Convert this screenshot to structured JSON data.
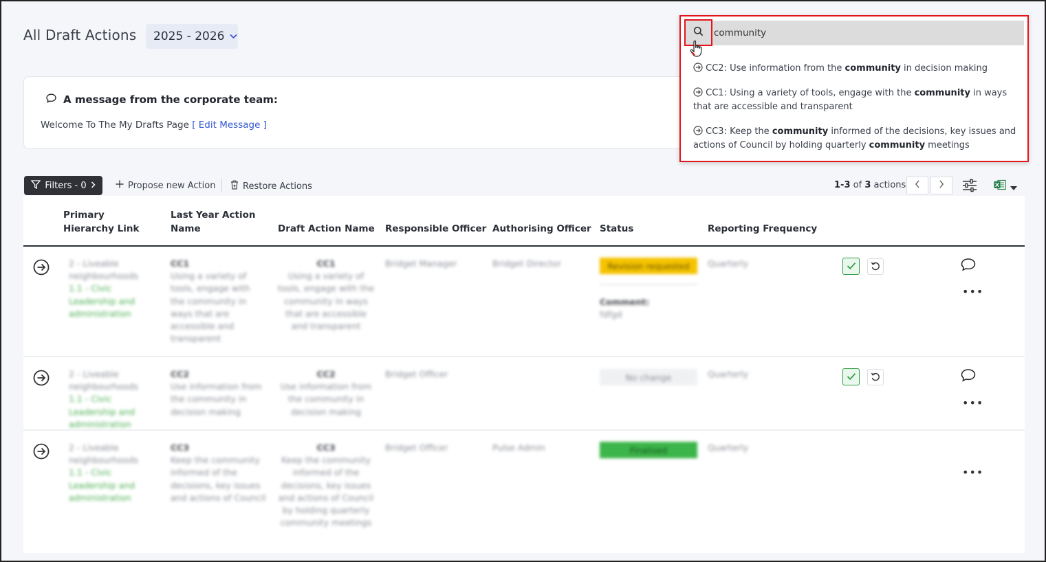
{
  "header": {
    "title": "All Draft Actions",
    "year": "2025 - 2026"
  },
  "message": {
    "title": "A message from the corporate team:",
    "body": "Welcome To The My Drafts Page",
    "link": "[ Edit Message ]"
  },
  "search": {
    "value": "community",
    "results": [
      {
        "prefix": "CC2: Use information from the ",
        "bold": "community",
        "suffix": " in decision making"
      },
      {
        "prefix": "CC1: Using a variety of tools, engage with the ",
        "bold": "community",
        "suffix": " in ways that are accessible and transparent"
      },
      {
        "prefix": "CC3: Keep the ",
        "bold": "community",
        "mid": " informed of the decisions, key issues and actions of Council by holding quarterly ",
        "bold2": "community",
        "suffix": " meetings"
      }
    ]
  },
  "toolbar": {
    "filters": "Filters - 0",
    "propose": "Propose new Action",
    "restore": "Restore Actions",
    "count_range": "1-3",
    "count_of": "of",
    "count_total": "3",
    "count_unit": "actions"
  },
  "table": {
    "headers": {
      "primary": "Primary Hierarchy Link",
      "last_year": "Last Year Action Name",
      "draft": "Draft Action Name",
      "responsible": "Responsible Officer",
      "authorising": "Authorising Officer",
      "status": "Status",
      "frequency": "Reporting Frequency"
    },
    "rows": [
      {
        "hier1": "2 - Liveable neighbourhoods",
        "hier2": "1.1 - Civic Leadership and administration",
        "last_code": "CC1",
        "last_text": "Using a variety of tools, engage with the community in ways that are accessible and transparent",
        "draft_code": "CC1",
        "draft_text": "Using a variety of tools, engage with the community in ways that are accessible and transparent",
        "responsible": "Bridget Manager",
        "authorising": "Bridget Director",
        "status": "Revision requested",
        "comment_label": "Comment:",
        "comment_text": "fdfgd",
        "frequency": "Quarterly"
      },
      {
        "hier1": "2 - Liveable neighbourhoods",
        "hier2": "1.1 - Civic Leadership and administration",
        "last_code": "CC2",
        "last_text": "Use information from the community in decision making",
        "draft_code": "CC2",
        "draft_text": "Use information from the community in decision making",
        "responsible": "Bridget Officer",
        "authorising": "",
        "status": "No change",
        "frequency": "Quarterly"
      },
      {
        "hier1": "2 - Liveable neighbourhoods",
        "hier2": "1.1 - Civic Leadership and administration",
        "last_code": "CC3",
        "last_text": "Keep the community informed of the decisions, key issues and actions of Council",
        "draft_code": "CC3",
        "draft_text": "Keep the community informed of the decisions, key issues and actions of Council by holding quarterly community meetings",
        "responsible": "Bridget Officer",
        "authorising": "Pulse Admin",
        "status": "Finalised",
        "frequency": "Quarterly"
      }
    ]
  },
  "colors": {
    "accent": "#3457d5",
    "highlight": "#e4141b",
    "status_revision": "#f5c300",
    "status_finalised": "#3cb54a",
    "hierarchy_green": "#4caf50"
  }
}
